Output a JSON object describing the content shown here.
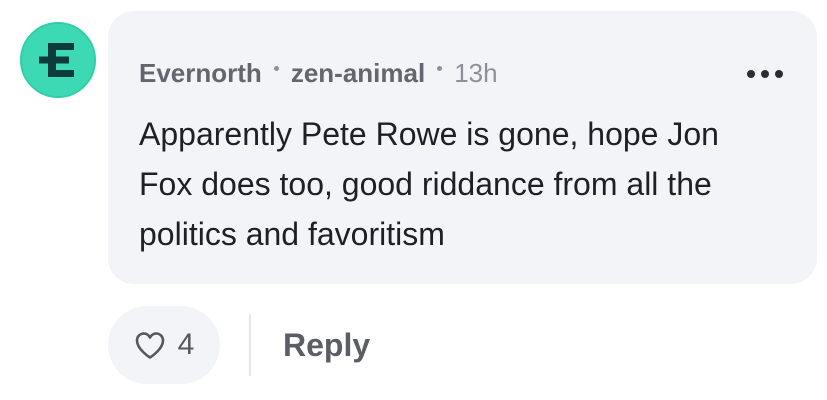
{
  "comment": {
    "author_name": "Evernorth",
    "username": "zen-animal",
    "timestamp": "13h",
    "body": "Apparently Pete Rowe is gone, hope Jon Fox does too, good riddance from all the politics and favoritism",
    "avatar_icon": "evernorth-logo-icon",
    "avatar_color": "#3dd9b4"
  },
  "actions": {
    "like_count": "4",
    "like_icon": "heart-icon",
    "reply_label": "Reply",
    "more_icon": "more-horizontal-icon"
  }
}
